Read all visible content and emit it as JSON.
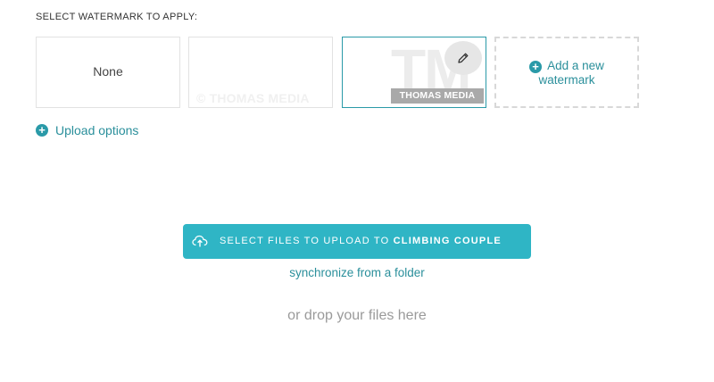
{
  "watermark": {
    "section_label": "SELECT WATERMARK TO APPLY:",
    "options": [
      {
        "label": "None"
      },
      {
        "label": "© THOMAS MEDIA"
      },
      {
        "label": "THOMAS MEDIA",
        "big_text": "TM",
        "selected": true
      },
      {
        "label": "Add a new\nwatermark"
      }
    ],
    "add_line1": "Add a new",
    "add_line2": "watermark",
    "edit_icon": "pencil-icon",
    "add_icon": "plus-circle-icon"
  },
  "upload_options_label": "Upload options",
  "upload": {
    "button_prefix": "SELECT FILES TO UPLOAD TO ",
    "button_target": "CLIMBING COUPLE",
    "button_icon": "cloud-upload-icon",
    "sync_link": "synchronize from a folder",
    "drop_text": "or drop your files here"
  },
  "colors": {
    "accent": "#2fb5c5",
    "link": "#2a8f9b",
    "selected_border": "#2a9aa8"
  }
}
